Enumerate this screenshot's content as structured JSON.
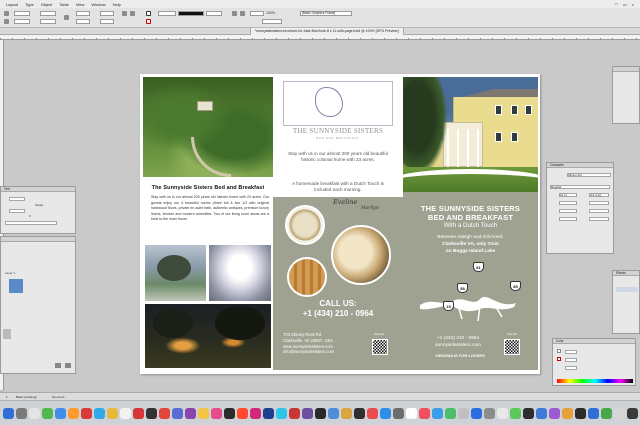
{
  "menubar": {
    "items": [
      "Layout",
      "Type",
      "Object",
      "Table",
      "View",
      "Window",
      "Help"
    ]
  },
  "controlbar": {
    "zoom": "100%",
    "style_label": "[Basic Graphics Frame]"
  },
  "document_tab": {
    "title": "*sunnysidesisters-brochure-for-Inde-Brochure-8 x 11-with-page.indd @ 100% [GPU Preview]"
  },
  "brochure": {
    "panel1": {
      "title": "The Sunnyside Sisters Bed and Breakfast",
      "body": "Stay with us in our almost 200 years old historic home with 23 acres. Our guests enjoy our 4 beautiful rooms (three full & two 1/2 with original hardwood floors, private en-suite bath, authentic antiques, premium luxury linens, shower and modern amenities. Two of our living room areas are a treat to the main floors."
    },
    "panel2": {
      "logo_title": "THE SUNNYSIDE SISTERS",
      "logo_sub": "BED AND BREAKFAST",
      "text1": "Stay with us in our almost 200 years old beautiful historic colonial home with 23 acres.",
      "text2": "A homemade breakfast with a Dutch Touch is included each morning.",
      "signature1": "Eveline",
      "signature2": "Marilyn",
      "call_label": "CALL US:",
      "phone": "+1 (434) 210 - 0964",
      "address": [
        "703 Shiney Rock Rd",
        "Clarksville, VA 23927, USA",
        "www.sunnysidesisters.com",
        "info@sunnysidesisters.com"
      ],
      "qr_label1": "Scan Me",
      "qr_label2": "Scan Me"
    },
    "panel3": {
      "title_line1": "THE SUNNYSIDE SISTERS",
      "title_line2": "BED AND BREAKFAST",
      "subtitle": "With a Dutch Touch",
      "between": "Between raleigh and richmond:",
      "town": "Clarksville VA, only 7min",
      "lake": "on Buggs Island Lake",
      "shields": [
        "81",
        "85",
        "58",
        "15"
      ],
      "phone": "+1 (434) 210 - 0964",
      "web": "sunnysidesisters.com",
      "va": "VIRGINIA IS FOR LOVERS",
      "qr_label": "Scan Me"
    }
  },
  "left_panels": {
    "character": {
      "tab": "Text",
      "leading_label": "Single",
      "tracking": "0"
    },
    "pages": {
      "layer_label": "Layer 1"
    }
  },
  "right_panels": {
    "character": {
      "title": "Character",
      "font": "Minion Pro",
      "style": "Regular",
      "size": "12 pt",
      "leading": "(14.4 pt)"
    },
    "stroke": {
      "title": "Effects"
    },
    "color": {
      "title": "Color"
    }
  },
  "status": {
    "page": "1",
    "info": "Basic (working)",
    "errors": "No errors"
  },
  "dock": {
    "icon_colors": [
      "#2f6fd6",
      "#7a7a7a",
      "#e4e4e4",
      "#4fb84f",
      "#3f8ee8",
      "#ff9a2e",
      "#d93a3a",
      "#30a9e8",
      "#e6b93a",
      "#f2f2f2",
      "#d7343a",
      "#333333",
      "#e0463a",
      "#5b6bd6",
      "#8e44ad",
      "#f4c542",
      "#e84c8a",
      "#2b2b2b",
      "#ff4a2f",
      "#d4287a",
      "#1f3f8f",
      "#2dc4e8",
      "#c83737",
      "#6b4fa0",
      "#2a2a2a",
      "#4f8ed6",
      "#d9a441",
      "#2f2f2f",
      "#e84c4c",
      "#2d8fe8",
      "#6d6d6d",
      "#ffffff",
      "#ef4f5f",
      "#3c9ee8",
      "#4bbf6b",
      "#c0c0c0",
      "#2a6ee0",
      "#8c8c8c",
      "#e8e8e8",
      "#5ac85a",
      "#2d2d2d",
      "#3f7ad6",
      "#9a5cd0",
      "#e8a13a",
      "#2b2b2b",
      "#2f6fd6",
      "#47a847",
      "#d6d6d6",
      "#3a3a3a",
      "#e04e4e"
    ]
  }
}
